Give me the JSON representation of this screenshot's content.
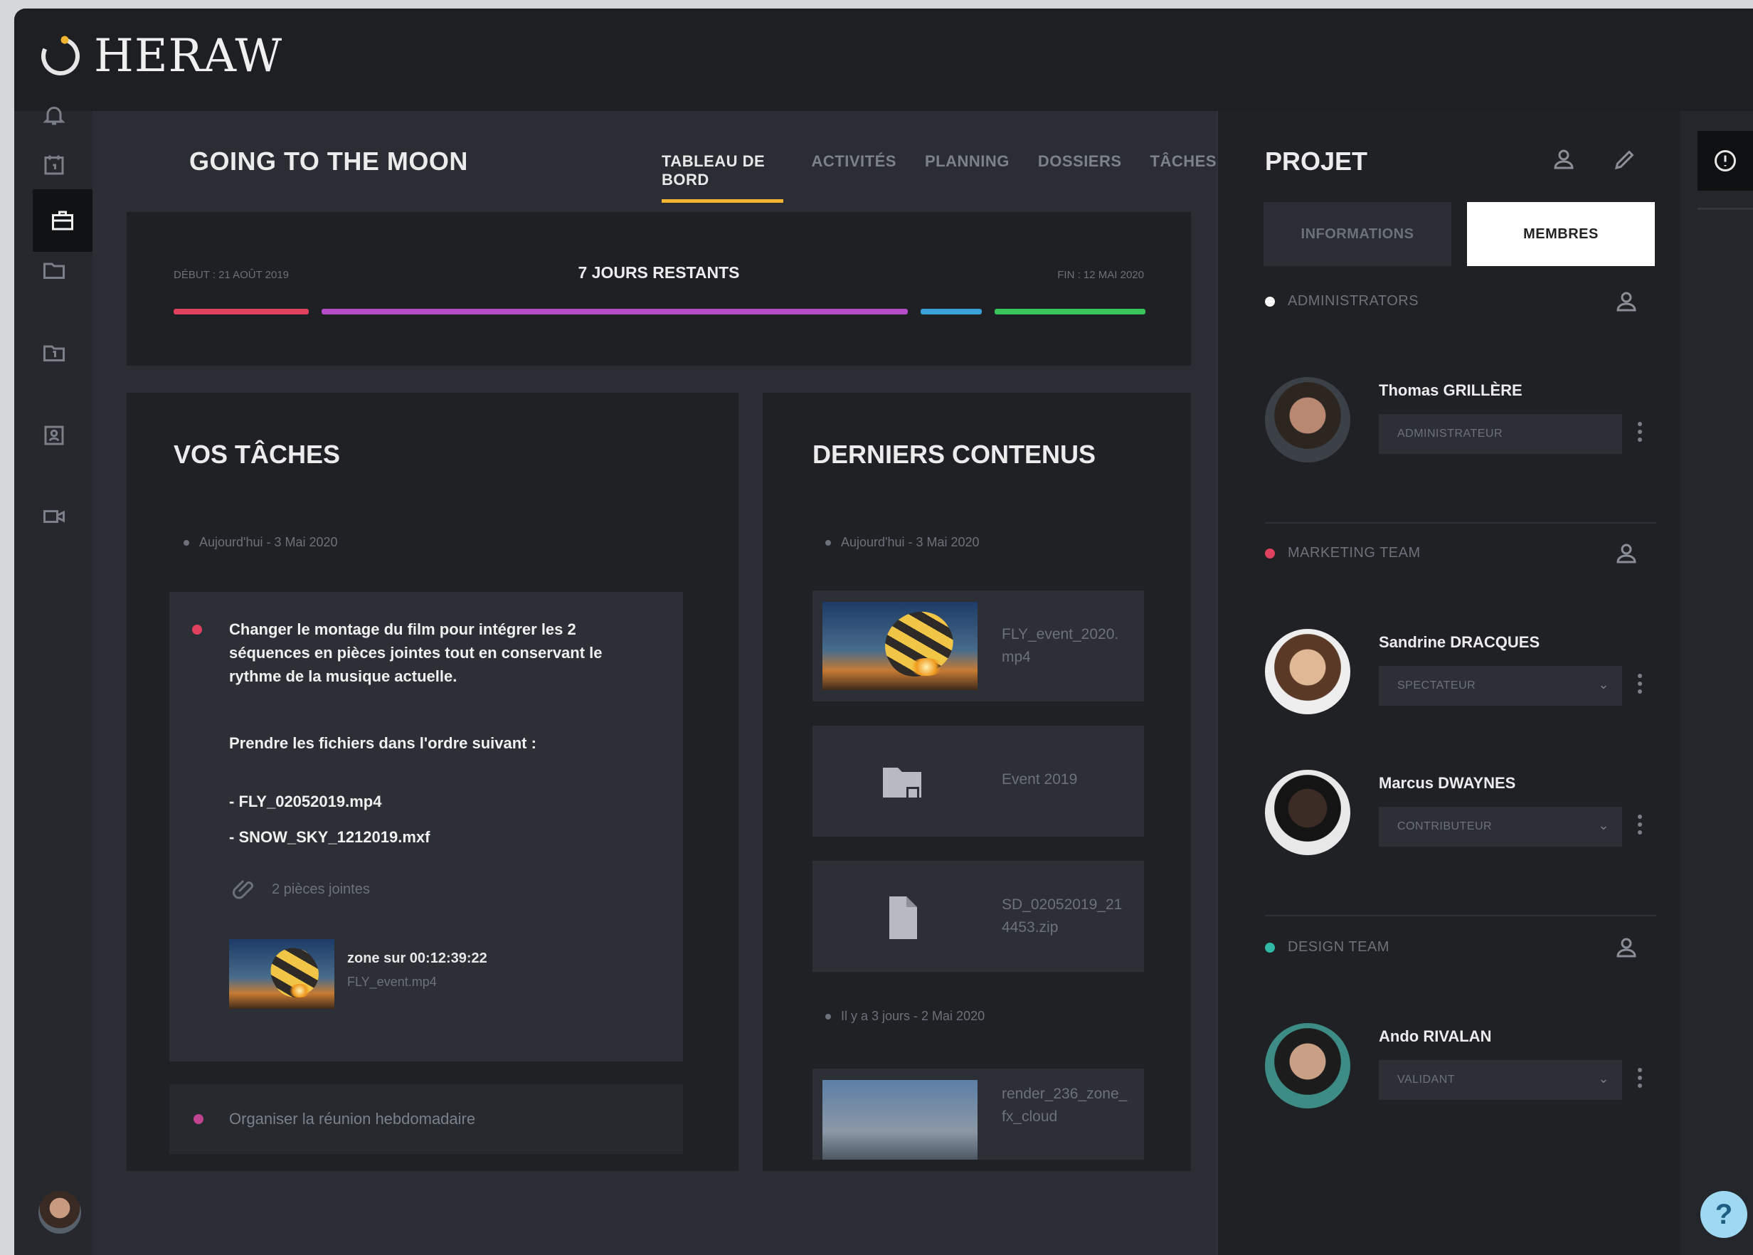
{
  "app": {
    "logo_text": "HERAW"
  },
  "header": {
    "project_title": "GOING TO THE MOON",
    "tabs": [
      {
        "label": "TABLEAU DE BORD",
        "active": true
      },
      {
        "label": "ACTIVITÉS",
        "active": false
      },
      {
        "label": "PLANNING",
        "active": false
      },
      {
        "label": "DOSSIERS",
        "active": false
      },
      {
        "label": "TÂCHES",
        "active": false
      }
    ]
  },
  "timeline": {
    "start_label": "DÉBUT : 21 AOÛT 2019",
    "remaining_label": "7 JOURS RESTANTS",
    "end_label": "FIN : 12 MAI 2020",
    "colors": [
      "#e0415f",
      "#b44cc7",
      "#3aa2d8",
      "#39c45c"
    ]
  },
  "tasks_panel": {
    "title": "VOS TÂCHES",
    "day_label": "Aujourd'hui - 3 Mai 2020",
    "task1": {
      "text": "Changer le montage du film pour intégrer les 2 séquences en pièces jointes tout en conservant le rythme de la musique actuelle.",
      "instruction": "Prendre les fichiers dans l'ordre suivant :",
      "file1": "- FLY_02052019.mp4",
      "file2": "- SNOW_SKY_1212019.mxf",
      "attachments_label": "2 pièces jointes",
      "attachment_title": "zone sur 00:12:39:22",
      "attachment_sub": "FLY_event.mp4"
    },
    "task2": {
      "text": "Organiser la réunion hebdomadaire"
    }
  },
  "content_panel": {
    "title": "DERNIERS CONTENUS",
    "day_label": "Aujourd'hui - 3 Mai 2020",
    "items": [
      {
        "name": "FLY_event_2020.mp4",
        "icon": "video-thumbnail"
      },
      {
        "name": "Event 2019",
        "icon": "folder-icon"
      },
      {
        "name": "SD_02052019_214453.zip",
        "icon": "file-icon"
      }
    ],
    "day_label2": "Il y a 3 jours - 2 Mai 2020",
    "item4": {
      "name": "render_236_zone_fx_cloud",
      "icon": "image-thumbnail"
    }
  },
  "project_panel": {
    "title": "PROJET",
    "tab_info": "INFORMATIONS",
    "tab_members": "MEMBRES",
    "groups": [
      {
        "name": "ADMINISTRATORS",
        "color": "#ffffff",
        "members": [
          {
            "name": "Thomas GRILLÈRE",
            "role": "ADMINISTRATEUR"
          }
        ]
      },
      {
        "name": "MARKETING TEAM",
        "color": "#e0415f",
        "members": [
          {
            "name": "Sandrine DRACQUES",
            "role": "SPECTATEUR"
          },
          {
            "name": "Marcus DWAYNES",
            "role": "CONTRIBUTEUR"
          }
        ]
      },
      {
        "name": "DESIGN TEAM",
        "color": "#2fb9a6",
        "members": [
          {
            "name": "Ando RIVALAN",
            "role": "VALIDANT"
          }
        ]
      }
    ]
  },
  "help": {
    "label": "?"
  }
}
